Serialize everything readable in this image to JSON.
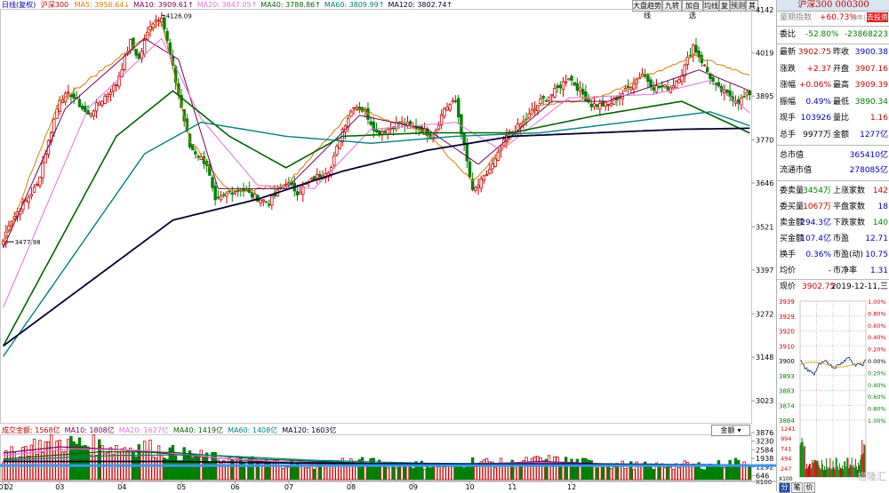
{
  "toolbar": {
    "buttons": [
      "大盘趋势线",
      "九转",
      "加自选",
      "均线",
      "复",
      "预测",
      "其"
    ]
  },
  "legend": {
    "prefix": "日线(复权)",
    "name": "沪深300",
    "items": [
      {
        "label": "MA5: 3956.64↓",
        "color": "#d28000"
      },
      {
        "label": "MA10: 3909.61↑",
        "color": "#7a005a"
      },
      {
        "label": "MA20: 3847.05↑",
        "color": "#e070e0"
      },
      {
        "label": "MA40: 3788.86↑",
        "color": "#006400"
      },
      {
        "label": "MA60: 3809.99↑",
        "color": "#008080"
      },
      {
        "label": "MA120: 3802.74↑",
        "color": "#000030"
      }
    ]
  },
  "vol_legend": {
    "items": [
      {
        "label": "成交金额: 1568亿",
        "color": "#c00000"
      },
      {
        "label": "MA10: 1808亿",
        "color": "#7a005a"
      },
      {
        "label": "MA20: 1627亿",
        "color": "#e070e0"
      },
      {
        "label": "MA40: 1419亿",
        "color": "#006400"
      },
      {
        "label": "MA60: 1408亿",
        "color": "#008080"
      },
      {
        "label": "MA120: 1603亿",
        "color": "#000030"
      }
    ],
    "dropdown": "金额"
  },
  "annotations": {
    "high": "4126.09",
    "low": "3477.98"
  },
  "chart_data": [
    {
      "type": "candlestick",
      "title": "沪深300 日线(复权)",
      "y_ticks": [
        4142,
        4019,
        3895,
        3770,
        3646,
        3521,
        3397,
        3272,
        3148,
        3023
      ],
      "ylim": [
        2960,
        4142
      ],
      "x_ticks": [
        "01",
        "02",
        "03",
        "04",
        "05",
        "06",
        "07",
        "08",
        "09",
        "10",
        "11",
        "12"
      ],
      "bars_per_month": [
        2,
        18,
        22,
        21,
        19,
        19,
        22,
        22,
        20,
        15,
        21,
        9
      ],
      "close_keypoints": [
        [
          0,
          3480
        ],
        [
          2,
          3530
        ],
        [
          12,
          3640
        ],
        [
          20,
          3890
        ],
        [
          24,
          3900
        ],
        [
          30,
          3840
        ],
        [
          40,
          3930
        ],
        [
          45,
          4050
        ],
        [
          48,
          4000
        ],
        [
          52,
          4100
        ],
        [
          56,
          4126
        ],
        [
          62,
          3900
        ],
        [
          66,
          3750
        ],
        [
          72,
          3700
        ],
        [
          75,
          3590
        ],
        [
          80,
          3620
        ],
        [
          84,
          3630
        ],
        [
          88,
          3610
        ],
        [
          94,
          3590
        ],
        [
          100,
          3650
        ],
        [
          104,
          3620
        ],
        [
          110,
          3660
        ],
        [
          116,
          3690
        ],
        [
          120,
          3800
        ],
        [
          124,
          3870
        ],
        [
          128,
          3850
        ],
        [
          132,
          3790
        ],
        [
          136,
          3800
        ],
        [
          140,
          3820
        ],
        [
          148,
          3800
        ],
        [
          152,
          3780
        ],
        [
          156,
          3860
        ],
        [
          160,
          3880
        ],
        [
          166,
          3620
        ],
        [
          170,
          3660
        ],
        [
          174,
          3710
        ],
        [
          178,
          3780
        ],
        [
          184,
          3820
        ],
        [
          190,
          3880
        ],
        [
          194,
          3900
        ],
        [
          200,
          3950
        ],
        [
          204,
          3910
        ],
        [
          208,
          3870
        ],
        [
          214,
          3870
        ],
        [
          220,
          3910
        ],
        [
          226,
          3960
        ],
        [
          230,
          3920
        ],
        [
          236,
          3920
        ],
        [
          240,
          3960
        ],
        [
          244,
          4040
        ],
        [
          248,
          3980
        ],
        [
          252,
          3920
        ],
        [
          256,
          3900
        ],
        [
          260,
          3880
        ],
        [
          264,
          3903
        ]
      ],
      "ma_values": {
        "MA5": [
          [
            0,
            3470
          ],
          [
            20,
            3880
          ],
          [
            45,
            4030
          ],
          [
            56,
            4110
          ],
          [
            66,
            3770
          ],
          [
            80,
            3620
          ],
          [
            100,
            3640
          ],
          [
            124,
            3860
          ],
          [
            150,
            3790
          ],
          [
            166,
            3650
          ],
          [
            190,
            3870
          ],
          [
            210,
            3890
          ],
          [
            244,
            4010
          ],
          [
            264,
            3957
          ]
        ],
        "MA10": [
          [
            0,
            3460
          ],
          [
            22,
            3860
          ],
          [
            50,
            4060
          ],
          [
            62,
            4000
          ],
          [
            76,
            3630
          ],
          [
            100,
            3630
          ],
          [
            126,
            3840
          ],
          [
            150,
            3800
          ],
          [
            168,
            3700
          ],
          [
            194,
            3880
          ],
          [
            214,
            3880
          ],
          [
            246,
            3970
          ],
          [
            264,
            3910
          ]
        ],
        "MA20": [
          [
            0,
            3290
          ],
          [
            30,
            3860
          ],
          [
            56,
            4060
          ],
          [
            70,
            3830
          ],
          [
            90,
            3640
          ],
          [
            110,
            3630
          ],
          [
            130,
            3800
          ],
          [
            160,
            3820
          ],
          [
            176,
            3740
          ],
          [
            200,
            3890
          ],
          [
            230,
            3900
          ],
          [
            250,
            3940
          ],
          [
            264,
            3847
          ]
        ],
        "MA40": [
          [
            0,
            3180
          ],
          [
            40,
            3780
          ],
          [
            60,
            3910
          ],
          [
            80,
            3780
          ],
          [
            100,
            3690
          ],
          [
            120,
            3780
          ],
          [
            150,
            3790
          ],
          [
            180,
            3790
          ],
          [
            210,
            3840
          ],
          [
            240,
            3880
          ],
          [
            264,
            3789
          ]
        ],
        "MA60": [
          [
            0,
            3150
          ],
          [
            50,
            3730
          ],
          [
            70,
            3820
          ],
          [
            100,
            3780
          ],
          [
            130,
            3760
          ],
          [
            160,
            3780
          ],
          [
            190,
            3790
          ],
          [
            220,
            3820
          ],
          [
            250,
            3850
          ],
          [
            264,
            3810
          ]
        ],
        "MA120": [
          [
            0,
            3180
          ],
          [
            60,
            3540
          ],
          [
            90,
            3600
          ],
          [
            120,
            3680
          ],
          [
            150,
            3740
          ],
          [
            180,
            3780
          ],
          [
            210,
            3790
          ],
          [
            240,
            3800
          ],
          [
            264,
            3803
          ]
        ]
      }
    },
    {
      "type": "bar",
      "title": "成交金额",
      "y_ticks": [
        3876,
        3230,
        2584,
        1938,
        1292,
        646
      ],
      "unit": "X100",
      "ylim": [
        0,
        3876
      ],
      "volume_keypoints": [
        [
          0,
          1800
        ],
        [
          10,
          2800
        ],
        [
          20,
          3000
        ],
        [
          30,
          2900
        ],
        [
          40,
          2600
        ],
        [
          50,
          2700
        ],
        [
          60,
          2200
        ],
        [
          70,
          1900
        ],
        [
          80,
          1600
        ],
        [
          90,
          1500
        ],
        [
          100,
          1300
        ],
        [
          110,
          1200
        ],
        [
          120,
          1500
        ],
        [
          130,
          1400
        ],
        [
          140,
          1300
        ],
        [
          150,
          1200
        ],
        [
          160,
          1100
        ],
        [
          166,
          1500
        ],
        [
          180,
          1300
        ],
        [
          190,
          1600
        ],
        [
          200,
          1500
        ],
        [
          210,
          1300
        ],
        [
          220,
          1200
        ],
        [
          230,
          1100
        ],
        [
          240,
          1200
        ],
        [
          250,
          1150
        ],
        [
          264,
          1568
        ]
      ],
      "highlight_level": 1160
    },
    {
      "type": "line",
      "title": "分时",
      "current_price": "3902.75",
      "date": "2019-12-11,三",
      "y_ticks": [
        3939,
        3929,
        3920,
        3910,
        3900,
        3893,
        3883,
        3874,
        3864
      ],
      "pct_ticks": [
        "1.00%",
        "0.80%",
        "0.60%",
        "0.40%",
        "0.20%",
        "0.00%",
        "0.20%",
        "0.40%",
        "0.60%",
        "0.80%",
        "1.00%"
      ],
      "price_keypoints": [
        [
          0,
          3902
        ],
        [
          5,
          3897
        ],
        [
          10,
          3895
        ],
        [
          15,
          3893
        ],
        [
          20,
          3899
        ],
        [
          28,
          3901
        ],
        [
          36,
          3897
        ],
        [
          44,
          3900
        ],
        [
          52,
          3904
        ],
        [
          58,
          3898
        ],
        [
          63,
          3900
        ],
        [
          66,
          3898
        ],
        [
          70,
          3902
        ]
      ],
      "vol_ticks": [
        1241,
        994,
        741,
        494,
        247
      ],
      "vol_unit": "X100"
    }
  ],
  "panel": {
    "title": "沪深300 000300",
    "sub_left": "量期指数",
    "sub_mid": "+60.73%",
    "sub_mid2": "(3年)",
    "button": "去投资",
    "weibi": {
      "label": "委比",
      "value": "-52.80%",
      "value2": "-23868223"
    },
    "rows1": [
      {
        "l": "最新",
        "v": "3902.75",
        "c": "red",
        "l2": "昨收",
        "v2": "3900.38",
        "c2": ""
      },
      {
        "l": "涨跌",
        "v": "+2.37",
        "c": "red",
        "l2": "开盘",
        "v2": "3907.16",
        "c2": "red"
      },
      {
        "l": "涨幅",
        "v": "+0.06%",
        "c": "red",
        "l2": "最高",
        "v2": "3909.39",
        "c2": "red"
      },
      {
        "l": "振幅",
        "v": "0.49%",
        "c": "blu",
        "l2": "最低",
        "v2": "3890.34",
        "c2": "grn"
      },
      {
        "l": "现手",
        "v": "103926",
        "c": "blu",
        "l2": "量比",
        "v2": "1.16",
        "c2": "red"
      },
      {
        "l": "总手",
        "v": "9977万",
        "c": "",
        "l2": "金额",
        "v2": "1277亿",
        "c2": "blu"
      }
    ],
    "rows2": [
      {
        "l": "总市值",
        "v2": "365410亿"
      },
      {
        "l": "流通市值",
        "v2": "278085亿"
      }
    ],
    "rows3": [
      {
        "l": "委卖量",
        "v": "3454万",
        "c": "grn",
        "l2": "上涨家数",
        "v2": "142",
        "c2": "red"
      },
      {
        "l": "委买量",
        "v": "1067万",
        "c": "red",
        "l2": "平盘家数",
        "v2": "18",
        "c2": "blu"
      },
      {
        "l": "卖金额",
        "v": "294.3亿",
        "c": "blu",
        "l2": "下跌家数",
        "v2": "140",
        "c2": "grn"
      },
      {
        "l": "买金额",
        "v": "107.4亿",
        "c": "blu",
        "l2": "市盈",
        "v2": "12.71",
        "c2": ""
      },
      {
        "l": "换手",
        "v": "0.36%",
        "c": "blu",
        "l2": "市盈(动)",
        "v2": "10.75",
        "c2": ""
      },
      {
        "l": "均价",
        "v": "-",
        "c": "",
        "l2": "市净率",
        "v2": "1.31",
        "c2": ""
      }
    ],
    "now_label": "现价",
    "tabs": [
      "分",
      "笔",
      "价"
    ],
    "watermark": "格隆汇"
  }
}
